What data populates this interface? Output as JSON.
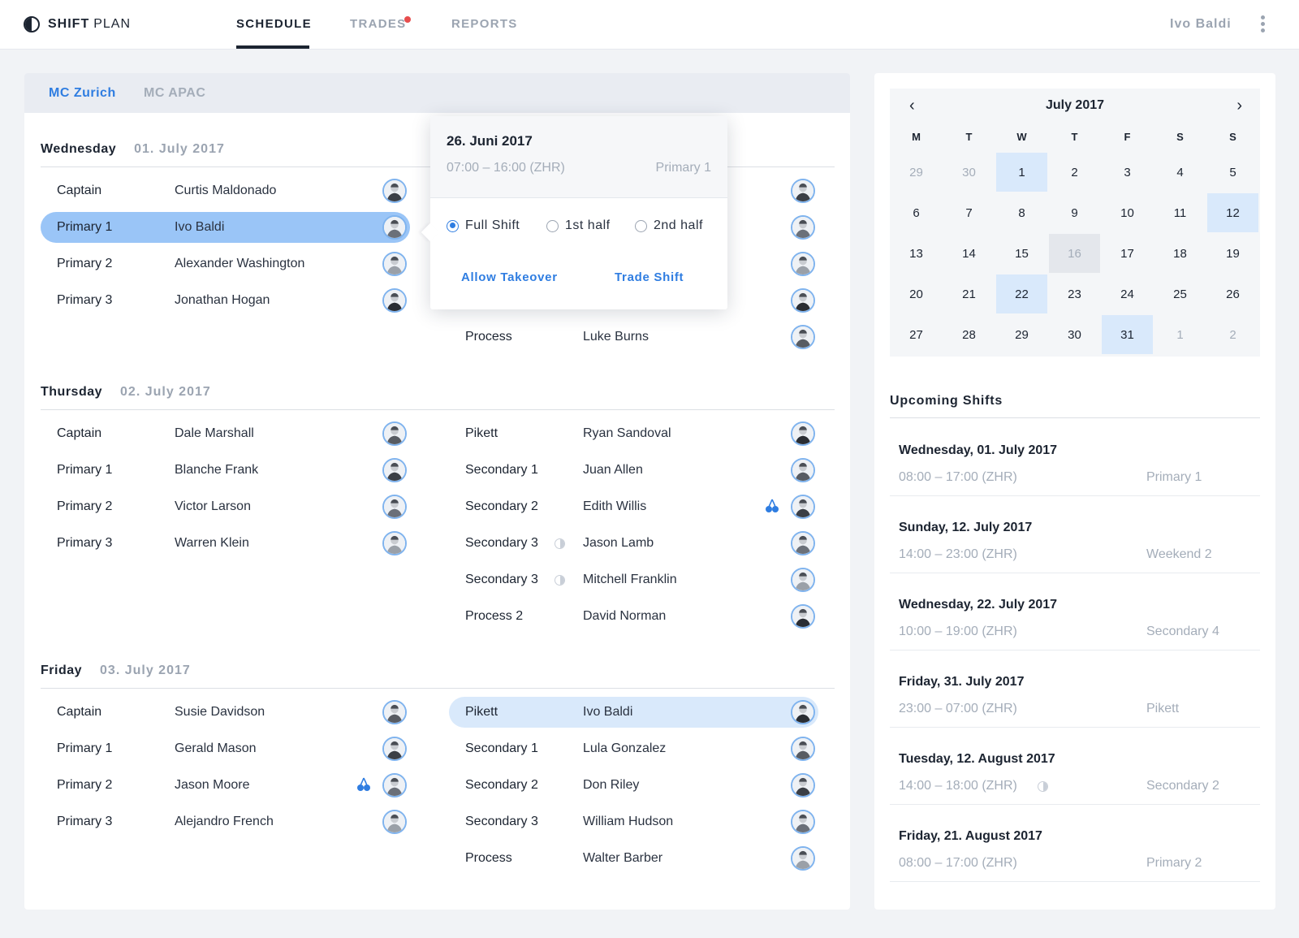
{
  "app": {
    "logo_bold": "SHIFT",
    "logo_light": "PLAN"
  },
  "nav": {
    "tabs": [
      "SCHEDULE",
      "TRADES",
      "REPORTS"
    ],
    "active": "SCHEDULE",
    "trades_has_notification": true
  },
  "user": {
    "name": "Ivo Baldi"
  },
  "locations": {
    "tabs": [
      "MC Zurich",
      "MC APAC"
    ],
    "active": "MC Zurich"
  },
  "days": [
    {
      "name": "Wednesday",
      "date": "01. July 2017",
      "left": [
        {
          "role": "Captain",
          "name": "Curtis Maldonado"
        },
        {
          "role": "Primary 1",
          "name": "Ivo Baldi",
          "highlight": true
        },
        {
          "role": "Primary 2",
          "name": "Alexander Washington"
        },
        {
          "role": "Primary 3",
          "name": "Jonathan Hogan"
        }
      ],
      "right_visible": [
        {
          "role": "Process",
          "name": "Luke Burns"
        }
      ]
    },
    {
      "name": "Thursday",
      "date": "02. July 2017",
      "left": [
        {
          "role": "Captain",
          "name": "Dale Marshall"
        },
        {
          "role": "Primary 1",
          "name": "Blanche Frank"
        },
        {
          "role": "Primary 2",
          "name": "Victor Larson"
        },
        {
          "role": "Primary 3",
          "name": "Warren Klein"
        }
      ],
      "right": [
        {
          "role": "Pikett",
          "name": "Ryan Sandoval"
        },
        {
          "role": "Secondary 1",
          "name": "Juan Allen"
        },
        {
          "role": "Secondary 2",
          "name": "Edith Willis",
          "icon": "cherry-icon"
        },
        {
          "role": "Secondary 3",
          "name": "Jason Lamb",
          "icon": "half-shift-icon"
        },
        {
          "role": "Secondary 3",
          "name": "Mitchell Franklin",
          "icon": "half-shift-icon"
        },
        {
          "role": "Process 2",
          "name": "David Norman"
        }
      ]
    },
    {
      "name": "Friday",
      "date": "03. July 2017",
      "left": [
        {
          "role": "Captain",
          "name": "Susie Davidson"
        },
        {
          "role": "Primary 1",
          "name": "Gerald Mason"
        },
        {
          "role": "Primary 2",
          "name": "Jason Moore",
          "icon": "cherry-icon"
        },
        {
          "role": "Primary 3",
          "name": "Alejandro French"
        }
      ],
      "right": [
        {
          "role": "Pikett",
          "name": "Ivo Baldi",
          "highlight": true
        },
        {
          "role": "Secondary 1",
          "name": "Lula Gonzalez"
        },
        {
          "role": "Secondary 2",
          "name": "Don Riley"
        },
        {
          "role": "Secondary 3",
          "name": "William Hudson"
        },
        {
          "role": "Process",
          "name": "Walter Barber"
        }
      ]
    }
  ],
  "popover": {
    "title": "26. Juni 2017",
    "time": "07:00 – 16:00 (ZHR)",
    "role": "Primary 1",
    "options": [
      "Full Shift",
      "1st half",
      "2nd half"
    ],
    "selected": "Full Shift",
    "actions": {
      "allow_takeover": "Allow Takeover",
      "trade_shift": "Trade Shift"
    }
  },
  "calendar": {
    "title": "July 2017",
    "prev_icon": "chevron-left-icon",
    "next_icon": "chevron-right-icon",
    "weekdays": [
      "M",
      "T",
      "W",
      "T",
      "F",
      "S",
      "S"
    ],
    "weeks": [
      [
        "29",
        "30",
        "1",
        "2",
        "3",
        "4",
        "5"
      ],
      [
        "6",
        "7",
        "8",
        "9",
        "10",
        "11",
        "12"
      ],
      [
        "13",
        "14",
        "15",
        "16",
        "17",
        "18",
        "19"
      ],
      [
        "20",
        "21",
        "22",
        "23",
        "24",
        "25",
        "26"
      ],
      [
        "27",
        "28",
        "29",
        "30",
        "31",
        "1",
        "2"
      ]
    ],
    "outside_month": [
      "0-0",
      "0-1",
      "4-5",
      "4-6"
    ],
    "shift_days": [
      "0-2",
      "1-6",
      "3-2",
      "4-4"
    ],
    "today": "2-3"
  },
  "upcoming": {
    "title": "Upcoming Shifts",
    "items": [
      {
        "date": "Wednesday, 01. July 2017",
        "time": "08:00 – 17:00 (ZHR)",
        "role": "Primary 1"
      },
      {
        "date": "Sunday, 12. July 2017",
        "time": "14:00 – 23:00 (ZHR)",
        "role": "Weekend 2"
      },
      {
        "date": "Wednesday, 22. July 2017",
        "time": "10:00 – 19:00 (ZHR)",
        "role": "Secondary 4"
      },
      {
        "date": "Friday, 31. July 2017",
        "time": "23:00 – 07:00 (ZHR)",
        "role": "Pikett"
      },
      {
        "date": "Tuesday, 12. August 2017",
        "time": "14:00 – 18:00 (ZHR)",
        "role": "Secondary 2",
        "icon": "half-shift-icon"
      },
      {
        "date": "Friday, 21. August 2017",
        "time": "08:00 – 17:00 (ZHR)",
        "role": "Primary 2"
      }
    ]
  },
  "colors": {
    "accent": "#2f7de1",
    "highlight": "#9ac5f7",
    "highlight_light": "#d9e9fb",
    "notification": "#e74d4d"
  }
}
